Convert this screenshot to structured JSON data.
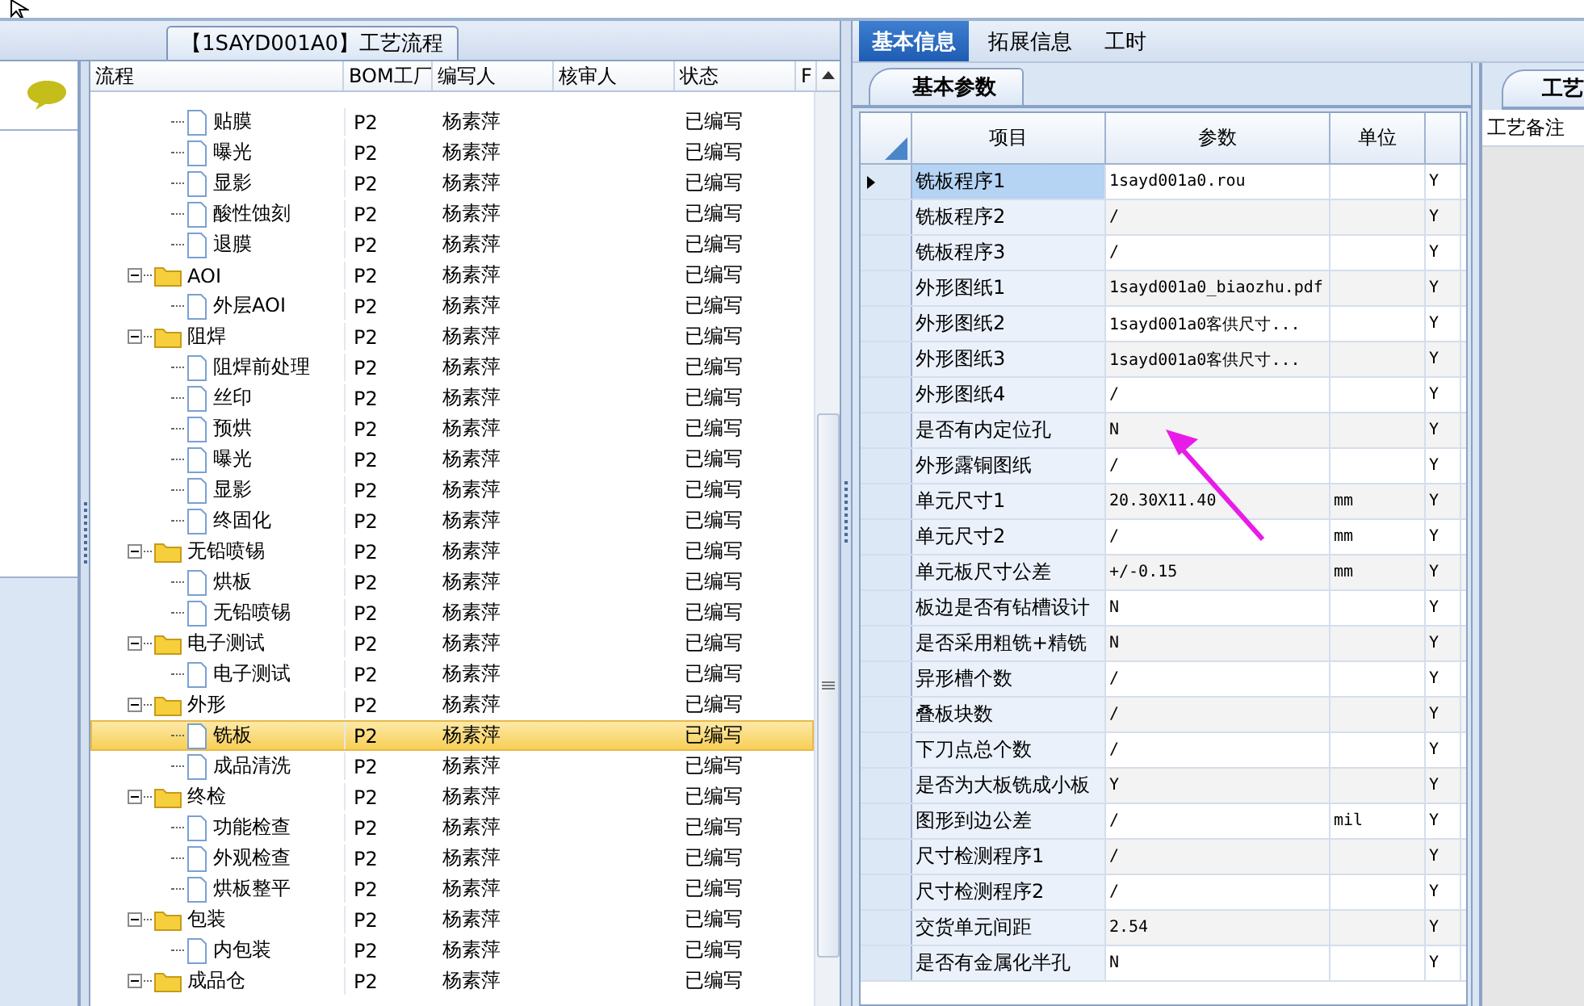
{
  "flow_panel": {
    "title": "【1SAYD001A0】工艺流程",
    "columns": [
      "流程",
      "BOM工厂",
      "编写人",
      "核审人",
      "状态",
      "F"
    ],
    "rows": [
      {
        "kind": "leaf",
        "name": "贴膜",
        "bom": "P2",
        "author": "杨素萍",
        "status": "已编写",
        "selected": false
      },
      {
        "kind": "leaf",
        "name": "曝光",
        "bom": "P2",
        "author": "杨素萍",
        "status": "已编写",
        "selected": false
      },
      {
        "kind": "leaf",
        "name": "显影",
        "bom": "P2",
        "author": "杨素萍",
        "status": "已编写",
        "selected": false
      },
      {
        "kind": "leaf",
        "name": "酸性蚀刻",
        "bom": "P2",
        "author": "杨素萍",
        "status": "已编写",
        "selected": false
      },
      {
        "kind": "leaf",
        "name": "退膜",
        "bom": "P2",
        "author": "杨素萍",
        "status": "已编写",
        "selected": false
      },
      {
        "kind": "folder",
        "name": "AOI",
        "bom": "P2",
        "author": "杨素萍",
        "status": "已编写",
        "selected": false,
        "expanded": true,
        "children": [
          {
            "kind": "leaf",
            "name": "外层AOI",
            "bom": "P2",
            "author": "杨素萍",
            "status": "已编写",
            "selected": false
          }
        ]
      },
      {
        "kind": "folder",
        "name": "阻焊",
        "bom": "P2",
        "author": "杨素萍",
        "status": "已编写",
        "selected": false,
        "expanded": true,
        "children": [
          {
            "kind": "leaf",
            "name": "阻焊前处理",
            "bom": "P2",
            "author": "杨素萍",
            "status": "已编写",
            "selected": false
          },
          {
            "kind": "leaf",
            "name": "丝印",
            "bom": "P2",
            "author": "杨素萍",
            "status": "已编写",
            "selected": false
          },
          {
            "kind": "leaf",
            "name": "预烘",
            "bom": "P2",
            "author": "杨素萍",
            "status": "已编写",
            "selected": false
          },
          {
            "kind": "leaf",
            "name": "曝光",
            "bom": "P2",
            "author": "杨素萍",
            "status": "已编写",
            "selected": false
          },
          {
            "kind": "leaf",
            "name": "显影",
            "bom": "P2",
            "author": "杨素萍",
            "status": "已编写",
            "selected": false
          },
          {
            "kind": "leaf",
            "name": "终固化",
            "bom": "P2",
            "author": "杨素萍",
            "status": "已编写",
            "selected": false
          }
        ]
      },
      {
        "kind": "folder",
        "name": "无铅喷锡",
        "bom": "P2",
        "author": "杨素萍",
        "status": "已编写",
        "selected": false,
        "expanded": true,
        "children": [
          {
            "kind": "leaf",
            "name": "烘板",
            "bom": "P2",
            "author": "杨素萍",
            "status": "已编写",
            "selected": false
          },
          {
            "kind": "leaf",
            "name": "无铅喷锡",
            "bom": "P2",
            "author": "杨素萍",
            "status": "已编写",
            "selected": false
          }
        ]
      },
      {
        "kind": "folder",
        "name": "电子测试",
        "bom": "P2",
        "author": "杨素萍",
        "status": "已编写",
        "selected": false,
        "expanded": true,
        "children": [
          {
            "kind": "leaf",
            "name": "电子测试",
            "bom": "P2",
            "author": "杨素萍",
            "status": "已编写",
            "selected": false
          }
        ]
      },
      {
        "kind": "folder",
        "name": "外形",
        "bom": "P2",
        "author": "杨素萍",
        "status": "已编写",
        "selected": false,
        "expanded": true,
        "children": [
          {
            "kind": "leaf",
            "name": "铣板",
            "bom": "P2",
            "author": "杨素萍",
            "status": "已编写",
            "selected": true
          },
          {
            "kind": "leaf",
            "name": "成品清洗",
            "bom": "P2",
            "author": "杨素萍",
            "status": "已编写",
            "selected": false
          }
        ]
      },
      {
        "kind": "folder",
        "name": "终检",
        "bom": "P2",
        "author": "杨素萍",
        "status": "已编写",
        "selected": false,
        "expanded": true,
        "children": [
          {
            "kind": "leaf",
            "name": "功能检查",
            "bom": "P2",
            "author": "杨素萍",
            "status": "已编写",
            "selected": false
          },
          {
            "kind": "leaf",
            "name": "外观检查",
            "bom": "P2",
            "author": "杨素萍",
            "status": "已编写",
            "selected": false
          },
          {
            "kind": "leaf",
            "name": "烘板整平",
            "bom": "P2",
            "author": "杨素萍",
            "status": "已编写",
            "selected": false
          }
        ]
      },
      {
        "kind": "folder",
        "name": "包装",
        "bom": "P2",
        "author": "杨素萍",
        "status": "已编写",
        "selected": false,
        "expanded": true,
        "children": [
          {
            "kind": "leaf",
            "name": "内包装",
            "bom": "P2",
            "author": "杨素萍",
            "status": "已编写",
            "selected": false
          }
        ]
      },
      {
        "kind": "folder",
        "name": "成品仓",
        "bom": "P2",
        "author": "杨素萍",
        "status": "已编写",
        "selected": false,
        "expanded": true
      }
    ]
  },
  "info_panel": {
    "tabs": [
      {
        "label": "基本信息",
        "selected": true
      },
      {
        "label": "拓展信息",
        "selected": false
      },
      {
        "label": "工时",
        "selected": false
      }
    ],
    "subtab": "基本参数",
    "columns": [
      "项目",
      "参数",
      "单位"
    ],
    "rows": [
      {
        "item": "铣板程序1",
        "value": "1sayd001a0.rou",
        "flag": "Y",
        "selected": true
      },
      {
        "item": "铣板程序2",
        "value": "/",
        "flag": "Y",
        "selected": false
      },
      {
        "item": "铣板程序3",
        "value": "/",
        "flag": "Y",
        "selected": false
      },
      {
        "item": "外形图纸1",
        "value": "1sayd001a0_biaozhu.pdf",
        "flag": "Y",
        "selected": false
      },
      {
        "item": "外形图纸2",
        "value": "1sayd001a0客供尺寸...",
        "flag": "Y",
        "selected": false
      },
      {
        "item": "外形图纸3",
        "value": "1sayd001a0客供尺寸...",
        "flag": "Y",
        "selected": false
      },
      {
        "item": "外形图纸4",
        "value": "/",
        "flag": "Y",
        "selected": false
      },
      {
        "item": "是否有内定位孔",
        "value": "N",
        "flag": "Y",
        "selected": false
      },
      {
        "item": "外形露铜图纸",
        "value": "/",
        "flag": "Y",
        "selected": false
      },
      {
        "item": "单元尺寸1",
        "value": "20.30X11.40",
        "unit": "mm",
        "flag": "Y",
        "selected": false
      },
      {
        "item": "单元尺寸2",
        "value": "/",
        "unit": "mm",
        "flag": "Y",
        "selected": false
      },
      {
        "item": "单元板尺寸公差",
        "value": "+/-0.15",
        "unit": "mm",
        "flag": "Y",
        "selected": false
      },
      {
        "item": "板边是否有钻槽设计",
        "value": "N",
        "flag": "Y",
        "selected": false
      },
      {
        "item": "是否采用粗铣+精铣",
        "value": "N",
        "flag": "Y",
        "selected": false
      },
      {
        "item": "异形槽个数",
        "value": "/",
        "flag": "Y",
        "selected": false
      },
      {
        "item": "叠板块数",
        "value": "/",
        "flag": "Y",
        "selected": false
      },
      {
        "item": "下刀点总个数",
        "value": "/",
        "flag": "Y",
        "selected": false
      },
      {
        "item": "是否为大板铣成小板",
        "value": "Y",
        "flag": "Y",
        "selected": false
      },
      {
        "item": "图形到边公差",
        "value": "/",
        "unit": "mil",
        "flag": "Y",
        "selected": false
      },
      {
        "item": "尺寸检测程序1",
        "value": "/",
        "flag": "Y",
        "selected": false
      },
      {
        "item": "尺寸检测程序2",
        "value": "/",
        "flag": "Y",
        "selected": false
      },
      {
        "item": "交货单元间距",
        "value": "2.54",
        "flag": "Y",
        "selected": false
      },
      {
        "item": "是否有金属化半孔",
        "value": "N",
        "flag": "Y",
        "selected": false
      }
    ]
  },
  "notes_panel": {
    "tab": "工艺",
    "label": "工艺备注"
  }
}
